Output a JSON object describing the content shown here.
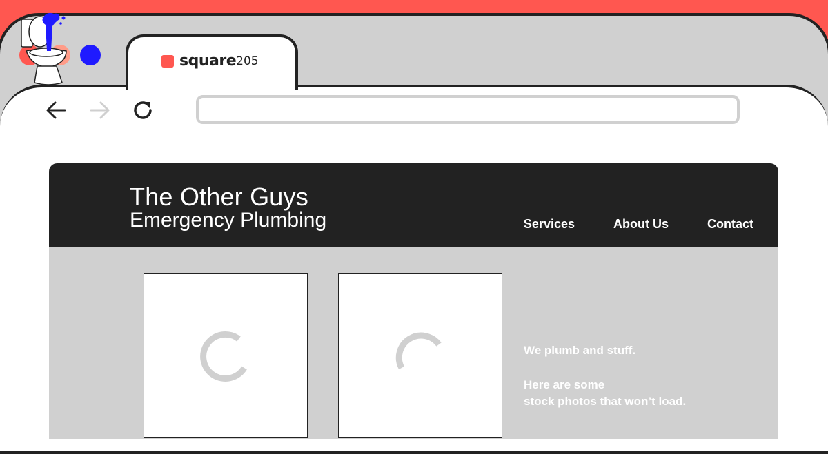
{
  "window": {
    "dots": [
      {
        "name": "close-dot",
        "color": "#ff5750"
      },
      {
        "name": "minimize-dot",
        "color": "#ff9c88"
      },
      {
        "name": "maximize-dot",
        "color": "#1f1aff"
      }
    ]
  },
  "tab": {
    "logo_main": "square",
    "logo_num": "205"
  },
  "toolbar": {
    "back_icon": "arrow-left-icon",
    "forward_icon": "arrow-right-icon",
    "reload_icon": "reload-icon",
    "url_value": ""
  },
  "site": {
    "brand_line1": "The Other Guys",
    "brand_line2": "Emergency Plumbing",
    "nav": [
      "Services",
      "About Us",
      "Contact"
    ],
    "tagline": "We plumb and stuff.",
    "copy_line1": "Here are some",
    "copy_line2": "stock photos that won’t load."
  },
  "colors": {
    "accent": "#ff5750",
    "header": "#222222",
    "content_bg": "#d0d0d0",
    "water": "#1f1aff"
  }
}
